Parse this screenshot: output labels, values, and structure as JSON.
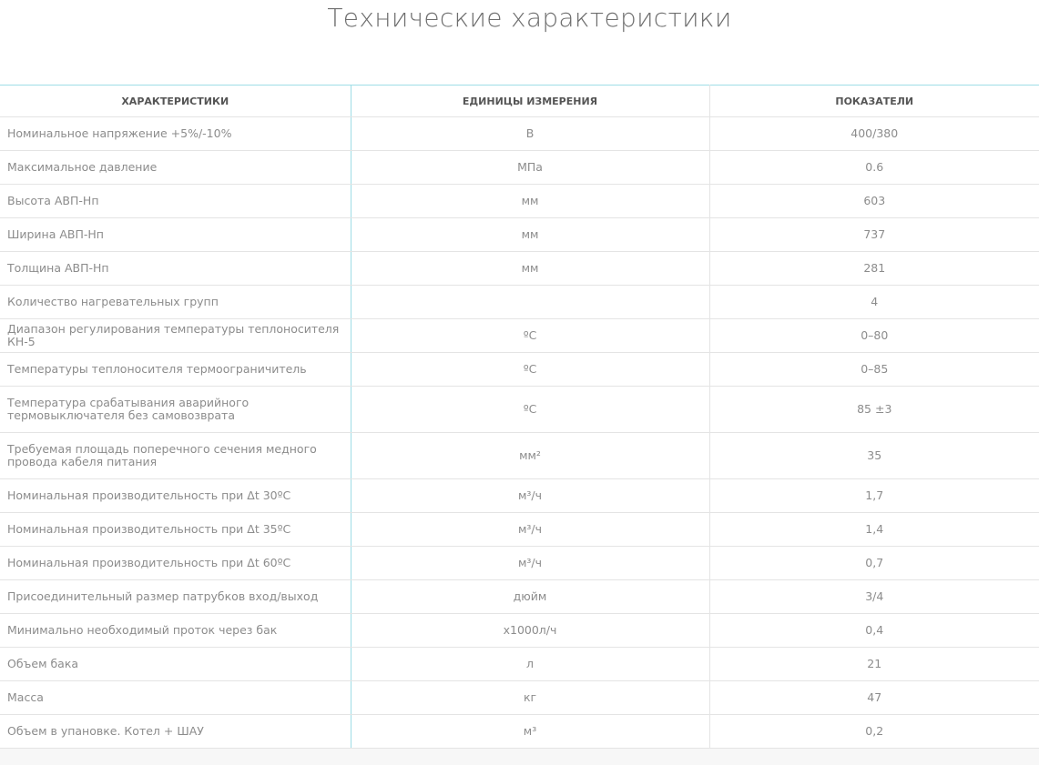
{
  "title": "Технические характеристики",
  "table": {
    "headers": {
      "name": "ХАРАКТЕРИСТИКИ",
      "unit": "ЕДИНИЦЫ ИЗМЕРЕНИЯ",
      "value": "ПОКАЗАТЕЛИ"
    },
    "rows": [
      {
        "name": "Номинальное напряжение +5%/-10%",
        "unit": "В",
        "value": "400/380"
      },
      {
        "name": "Максимальное давление",
        "unit": "МПа",
        "value": "0.6"
      },
      {
        "name": "Высота АВП-Нп",
        "unit": "мм",
        "value": "603"
      },
      {
        "name": "Ширина АВП-Нп",
        "unit": "мм",
        "value": "737"
      },
      {
        "name": "Толщина АВП-Нп",
        "unit": "мм",
        "value": "281"
      },
      {
        "name": "Количество нагревательных групп",
        "unit": "",
        "value": "4"
      },
      {
        "name": "Диапазон регулирования температуры теплоносителя КН-5",
        "unit": "ºС",
        "value": "0–80"
      },
      {
        "name": "Температуры теплоносителя термоограничитель",
        "unit": "ºС",
        "value": "0–85"
      },
      {
        "name": "Температура срабатывания аварийного термовыключателя без самовозврата",
        "unit": "ºС",
        "value": "85 ±3"
      },
      {
        "name": "Требуемая площадь поперечного сечения медного провода кабеля питания",
        "unit": "мм²",
        "value": "35"
      },
      {
        "name": "Номинальная производительность при Δt 30ºС",
        "unit": "м³/ч",
        "value": "1,7"
      },
      {
        "name": "Номинальная производительность при Δt 35ºС",
        "unit": "м³/ч",
        "value": "1,4"
      },
      {
        "name": "Номинальная производительность при Δt 60ºС",
        "unit": "м³/ч",
        "value": "0,7"
      },
      {
        "name": "Присоединительный размер патрубков вход/выход",
        "unit": "дюйм",
        "value": "3/4"
      },
      {
        "name": "Минимально необходимый проток через бак",
        "unit": "х1000л/ч",
        "value": "0,4"
      },
      {
        "name": "Объем бака",
        "unit": "л",
        "value": "21"
      },
      {
        "name": "Масса",
        "unit": "кг",
        "value": "47"
      },
      {
        "name": "Объем в упановке. Котел + ШАУ",
        "unit": "м³",
        "value": "0,2"
      }
    ]
  },
  "colors": {
    "accent_divider": "#9fdde6",
    "row_divider": "#e4e4e4",
    "title_text": "#6e6e6e",
    "body_text": "#8c8c8c"
  }
}
